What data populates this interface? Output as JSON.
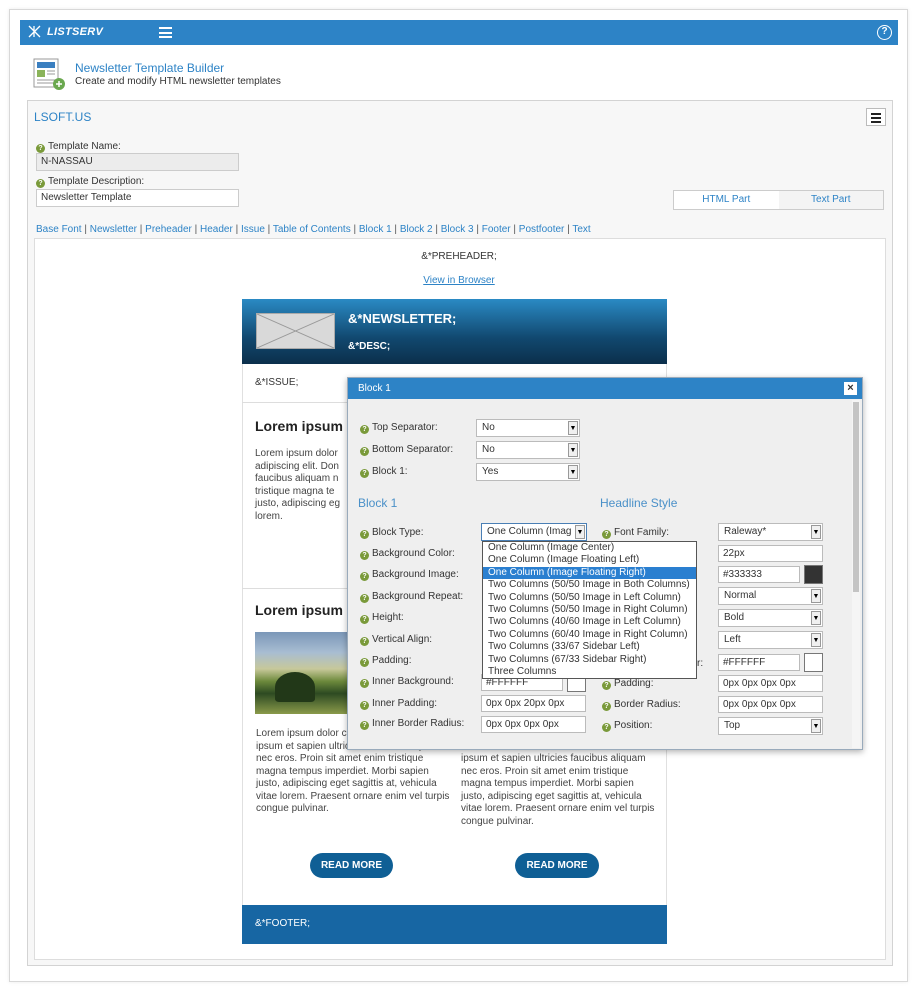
{
  "topbar": {
    "app_name": "LISTSERV"
  },
  "header": {
    "title": "Newsletter Template Builder",
    "subtitle": "Create and modify HTML newsletter templates"
  },
  "org": "LSOFT.US",
  "form": {
    "template_name_label": "Template Name:",
    "template_name_value": "N-NASSAU",
    "template_desc_label": "Template Description:",
    "template_desc_value": "Newsletter Template"
  },
  "parts": {
    "html": "HTML Part",
    "text": "Text Part"
  },
  "section_links": [
    "Base Font",
    "Newsletter",
    "Preheader",
    "Header",
    "Issue",
    "Table of Contents",
    "Block 1",
    "Block 2",
    "Block 3",
    "Footer",
    "Postfooter",
    "Text"
  ],
  "preview": {
    "preheader": "&*PREHEADER;",
    "view_in_browser": "View in Browser",
    "newsletter": "&*NEWSLETTER;",
    "desc": "&*DESC;",
    "issue": "&*ISSUE;",
    "block1_heading": "Lorem ipsum",
    "block1_text": "Lorem ipsum dolor adipiscing elit. Don faucibus aliquam n tristique magna te justo, adipiscing eg lorem.",
    "block2_heading": "Lorem ipsum",
    "col1_text": "Lorem ipsum dolor consectetur adipisc ipsum et sapien ultricies faucibus aliquam nec eros. Proin sit amet enim tristique magna tempus imperdiet. Morbi sapien justo, adipiscing eget sagittis at, vehicula vitae lorem. Praesent ornare enim vel turpis congue pulvinar.",
    "col2_text": "ipsum et sapien ultricies faucibus aliquam nec eros. Proin sit amet enim tristique magna tempus imperdiet. Morbi sapien justo, adipiscing eget sagittis at, vehicula vitae lorem. Praesent ornare enim vel turpis congue pulvinar.",
    "read_more": "READ MORE",
    "footer": "&*FOOTER;"
  },
  "dialog": {
    "title": "Block 1",
    "close": "×",
    "top_separator_label": "Top Separator:",
    "top_separator_value": "No",
    "bottom_separator_label": "Bottom Separator:",
    "bottom_separator_value": "No",
    "block1_label": "Block 1:",
    "block1_value": "Yes",
    "section_block": "Block 1",
    "section_headline": "Headline Style",
    "left_labels": [
      "Block Type:",
      "Background Color:",
      "Background Image:",
      "Background Repeat:",
      "Height:",
      "Vertical Align:",
      "Padding:",
      "Inner Background:",
      "Inner Padding:",
      "Inner Border Radius:"
    ],
    "block_type_value": "One Column (Imag",
    "inner_background_value": "#FFFFFF",
    "inner_padding_value": "0px 0px 20px 0px",
    "inner_border_radius_value": "0px 0px 0px 0px",
    "right_labels": {
      "font_family": "Font Family:",
      "padding": "Padding:",
      "border_radius": "Border Radius:",
      "position": "Position:",
      "partial": "r:"
    },
    "right_values": {
      "font_family": "Raleway*",
      "font_size": "22px",
      "color": "#333333",
      "style": "Normal",
      "weight": "Bold",
      "align": "Left",
      "bg": "#FFFFFF",
      "padding": "0px 0px 0px 0px",
      "border_radius": "0px 0px 0px 0px",
      "position": "Top"
    },
    "colors": {
      "swatch_dark": "#333333",
      "swatch_light": "#FFFFFF"
    }
  },
  "block_type_options": [
    "One Column (Image Center)",
    "One Column (Image Floating Left)",
    "One Column (Image Floating Right)",
    "Two Columns (50/50 Image in Both Columns)",
    "Two Columns (50/50 Image in Left Column)",
    "Two Columns (50/50 Image in Right Column)",
    "Two Columns (40/60 Image in Left Column)",
    "Two Columns (60/40 Image in Right Column)",
    "Two Columns (33/67 Sidebar Left)",
    "Two Columns (67/33 Sidebar Right)",
    "Three Columns"
  ],
  "selected_option_index": 2,
  "accent_color": "#2d83c6"
}
